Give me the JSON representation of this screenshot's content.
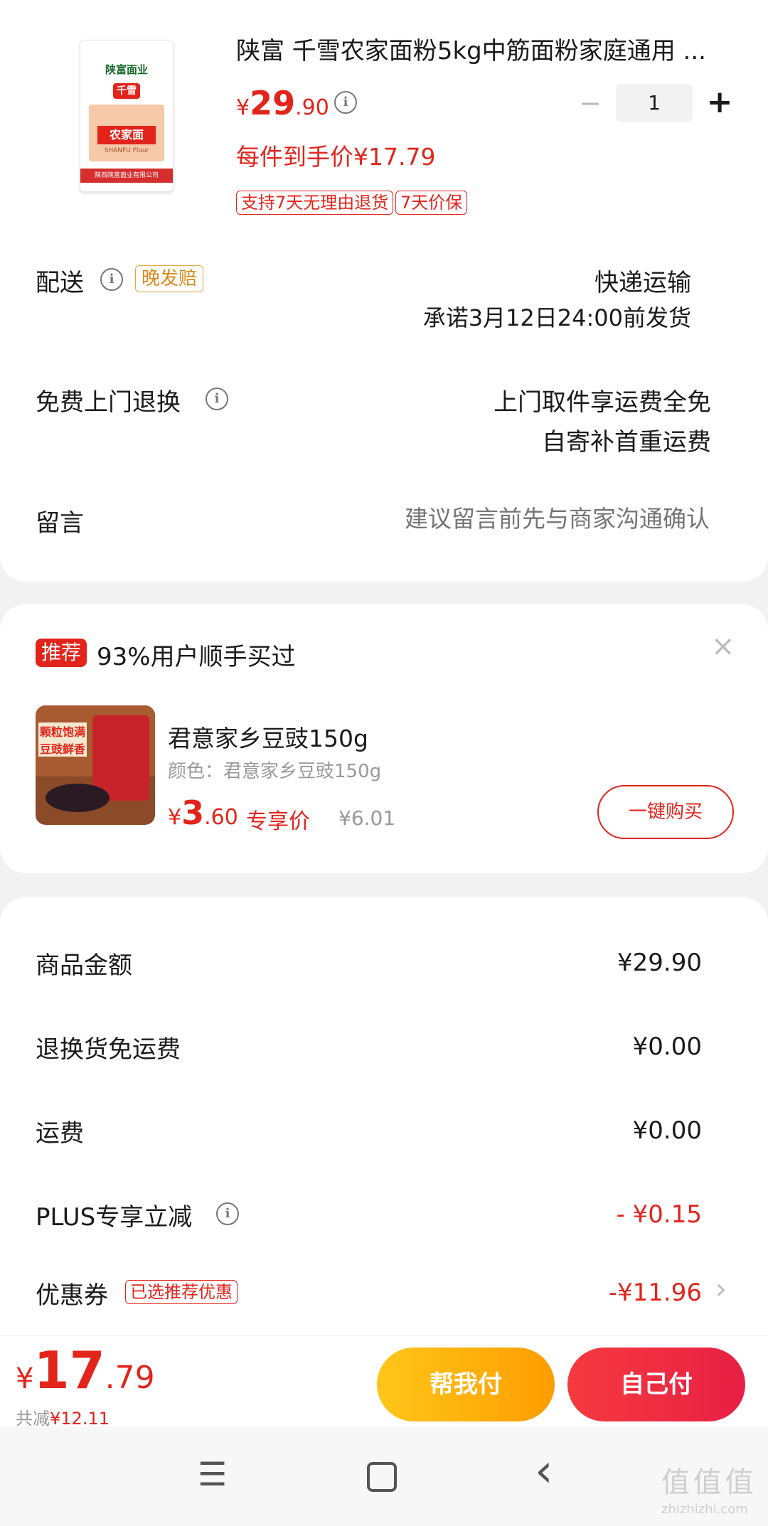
{
  "product": {
    "title": "陕富 千雪农家面粉5kg中筋面粉家庭通用 ...",
    "price_symbol": "¥",
    "price_int": "29",
    "price_dec": ".90",
    "per_item_price": "每件到手价¥17.79",
    "qty": "1",
    "minus": "−",
    "plus": "+",
    "tags": [
      "支持7天无理由退货",
      "7天价保"
    ],
    "image_brand": "陕富面业",
    "image_logo": "千雪",
    "image_name": "农家面",
    "image_en": "SHANFU Flour",
    "image_footer": "陕西陕富面业有限公司"
  },
  "delivery": {
    "label": "配送",
    "badge": "晚发赔",
    "method": "快递运输",
    "promise": "承诺3月12日24:00前发货"
  },
  "returns": {
    "label": "免费上门退换",
    "line1": "上门取件享运费全免",
    "line2": "自寄补首重运费"
  },
  "message": {
    "label": "留言",
    "placeholder": "建议留言前先与商家沟通确认"
  },
  "recommend": {
    "badge": "推荐",
    "title": "93%用户顺手买过",
    "close": "×",
    "item_name": "君意家乡豆豉150g",
    "item_spec": "颜色：君意家乡豆豉150g",
    "price_symbol": "¥",
    "price_int": "3",
    "price_dec": ".60",
    "price_tag": "专享价",
    "orig_price": "¥6.01",
    "buy_button": "一键购买",
    "image_text1": "颗粒饱满",
    "image_text2": "豆豉鲜香"
  },
  "summary": {
    "rows": [
      {
        "label": "商品金额",
        "value": "¥29.90"
      },
      {
        "label": "退换货免运费",
        "value": "¥0.00"
      },
      {
        "label": "运费",
        "value": "¥0.00"
      },
      {
        "label": "PLUS专享立减",
        "value": "- ¥0.15"
      },
      {
        "label": "优惠券",
        "value": "-¥11.96"
      }
    ],
    "coupon_badge": "已选推荐优惠",
    "chevron": "›"
  },
  "bottom": {
    "price_symbol": "¥",
    "total_int": "17",
    "total_dec": ".79",
    "saved_label": "共减",
    "saved_value": "¥12.11",
    "help_pay": "帮我付",
    "self_pay": "自己付"
  },
  "nav": {
    "menu": "☰",
    "home": "▢",
    "back": "‹"
  },
  "watermark": "值 值 值",
  "watermark_url": "zhizhizhi.com",
  "colors": {
    "accent_red": "#e3241b",
    "orange_start": "#ffc61a",
    "orange_end": "#ff9d00",
    "red_start": "#f53a3e",
    "red_end": "#e81f45"
  }
}
